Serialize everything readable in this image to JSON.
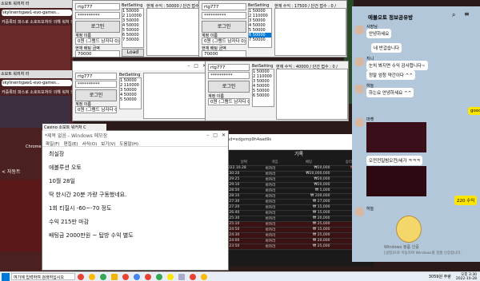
{
  "colors": {
    "chrome_red": "#ea4335",
    "chrome_yellow": "#fbbc05",
    "chrome_green": "#34a853",
    "kakao_yellow": "#fee500",
    "accent_blue": "#0078d7"
  },
  "browser": {
    "url1": "skylinentigaw1-evo-games...",
    "url2": "skylinentigaw1-evo-games...",
    "snippet1": "소모트 워저처 라",
    "snippet2": "카증록되 파스로 소호트보처아 의해 워처 노크로",
    "snippet3": "소모트 워저처 라",
    "snippet4": "카증록되 파스로 소호트보처아 의해 워처 노크로",
    "snippet5": "소모트 워저처 라",
    "left_text": "< 자동트"
  },
  "betwins": [
    {
      "id": "rtg777",
      "pw": "**********",
      "login": "로그인",
      "name_label": "계정 이름",
      "name_val": "0원 (그램드 남자다 0)",
      "bal_label": "현재 배팅 금액",
      "bal_val": "70000",
      "bet": "BetSetting",
      "load": "Load",
      "stat": "현재 수익 : 50000 / 단건 접수 : 0 /"
    },
    {
      "id": "rtg777",
      "pw": "**********",
      "login": "로그인",
      "name_label": "계정 이름",
      "name_val": "0원 (그램드 남자다 0)",
      "bal_label": "현재 배팅 금액",
      "bal_val": "70000",
      "bet": "BetSetting",
      "load": "Load",
      "stat": "현재 수익 : 17500 / 단건 접수 : 0 /"
    },
    {
      "id": "rtg777",
      "pw": "**********",
      "login": "로그인",
      "name_label": "계정 이름",
      "name_val": "0원 (그램드 남자다 0)",
      "bal_label": "현재 배팅 금액",
      "bal_val": "70000",
      "bet": "BetSetting",
      "load": "Load",
      "stat": "현재 수익 : 50000 / 단건 접수 : 0 /"
    },
    {
      "id": "rtg777",
      "pw": "**********",
      "login": "로그인",
      "name_label": "계정 이름",
      "name_val": "0원 (그램드 남자다 0)",
      "bal_label": "현재 배팅 금액",
      "bal_val": "70000",
      "bet": "BetSetting",
      "load": "Load",
      "stat": "현재 수익 : 40000 / 단건 접수 : 0 /"
    }
  ],
  "betlist": [
    "1 50000",
    "2 110000",
    "3 50000",
    "4 50000",
    "5 50000",
    "6 50000",
    "7 50000",
    "8 50000",
    "9 50000"
  ],
  "notepad": {
    "title": "*제목 없음 - Windows 메모장",
    "tab": "Casino 소모트 워커처 C",
    "menu": [
      "파일(F)",
      "편집(E)",
      "서식(O)",
      "보기(V)",
      "도움말(H)"
    ],
    "lines": [
      "최실장",
      "에볼루션 오토",
      "10월 28일",
      "딱 한시간 20분 가량 구동했네요.",
      "1회 티질시 -60~-70 정도",
      "수익 215만 마감",
      "배팅금 2000만원 ~ 탑방 수익 별도"
    ],
    "search": "Chrome"
  },
  "casino": {
    "title": "기록",
    "cols": [
      "날짜",
      "게임",
      "베팅",
      "승리/패배"
    ],
    "rows": [
      {
        "d": "2022.10.28",
        "g": "바카라",
        "b": "₩20,000",
        "w": "₩2,952,500",
        "t": "win"
      },
      {
        "d": "3:30:20",
        "g": "바카라",
        "b": "₩20,000,000",
        "w": "₩57,000",
        "t": "win"
      },
      {
        "d": "3:29:25",
        "g": "바카라",
        "b": "₩20,000",
        "w": "₩ 28,000",
        "t": "win"
      },
      {
        "d": "3:29:10",
        "g": "바카라",
        "b": "₩20,000",
        "w": "₩ -15,000",
        "t": "n"
      },
      {
        "d": "3:28:50",
        "g": "바카라",
        "b": "₩ 5,000",
        "w": "₩ -15,000",
        "t": "n"
      },
      {
        "d": "3:28:10",
        "g": "바카라",
        "b": "₩ 200,000",
        "w": "₩ 0",
        "t": "n"
      },
      {
        "d": "3:27:30",
        "g": "바카라",
        "b": "₩ 27,000",
        "w": "₩ -15,000",
        "t": "n"
      },
      {
        "d": "3:27:20",
        "g": "바카라",
        "b": "₩ 15,000",
        "w": "₩ -15,000",
        "t": "n"
      },
      {
        "d": "3:26:40",
        "g": "바카라",
        "b": "₩ 15,000",
        "w": "₩ -15,000",
        "t": "n"
      },
      {
        "d": "3:25:30",
        "g": "바카라",
        "b": "₩ 20,000",
        "w": "₩ 25,000",
        "t": "win"
      },
      {
        "d": "3:25:10",
        "g": "바카라",
        "b": "₩ 25,000",
        "w": "₩ -25,000",
        "t": "lose"
      },
      {
        "d": "3:24:50",
        "g": "바카라",
        "b": "₩ 15,000",
        "w": "₩ -15,000",
        "t": "lose"
      },
      {
        "d": "3:24:30",
        "g": "바카라",
        "b": "₩ 25,000",
        "w": "₩ -25,000",
        "t": "lose"
      },
      {
        "d": "3:24:00",
        "g": "바카라",
        "b": "₩ 20,000",
        "w": "₩ -20,000",
        "t": "lose"
      },
      {
        "d": "3:23:50",
        "g": "바카라",
        "b": "₩ 25,000",
        "w": "₩ -25,000",
        "t": "lose"
      }
    ],
    "addr": "ad=edgsmp9h4aad9s"
  },
  "kakao": {
    "title": "에볼오토 정보공유방",
    "count": "0",
    "msgs": [
      {
        "who": "사장님",
        "text": "안녕하세요",
        "mine": false
      },
      {
        "who": "",
        "text": "네 반갑습니다",
        "mine": true
      },
      {
        "who": "지니",
        "text": "눈치 봐지면 수익 감사합니다~",
        "mine": false
      },
      {
        "who": "",
        "text": "정말 엄청 약간이다 ^^",
        "mine": false
      },
      {
        "who": "하늘",
        "text": "하는요 안녕하세요 ^^",
        "mine": false
      },
      {
        "who": "",
        "text": "good",
        "mine": true
      },
      {
        "who": "마켓",
        "text": "오전전일밤오전/세가 ㅋㅋㅋ",
        "mine": false
      },
      {
        "who": "",
        "text": "220 수익",
        "mine": true
      },
      {
        "who": "하늘",
        "text": "",
        "mine": false
      }
    ],
    "notice": "Windows 정품 인증",
    "notice2": "[설정]으로 이동하여 Windows를 정품 인증합니다."
  },
  "taskbar": {
    "search": "여기에 입력하여 검색하십시오",
    "weather": "3059원 주량",
    "time": "오후 3:30",
    "date": "2022-10-28"
  }
}
